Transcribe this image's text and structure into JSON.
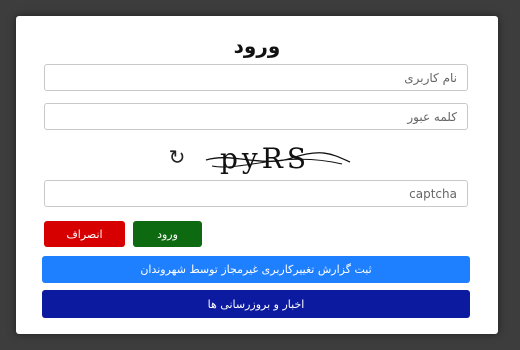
{
  "dialog": {
    "title": "ورود"
  },
  "form": {
    "username_placeholder": "نام کاربری",
    "password_placeholder": "کلمه عبور",
    "captcha_placeholder": "captcha",
    "captcha_text": "pyRS",
    "refresh_icon": "refresh-icon"
  },
  "buttons": {
    "login_label": "ورود",
    "cancel_label": "انصراف",
    "report_label": "ثبت گزارش تغییرکاربری غیرمجاز توسط شهروندان",
    "news_label": "اخبار و بروزرسانی ها"
  },
  "colors": {
    "cancel": "#d60000",
    "login": "#0e6a11",
    "report": "#1e7fff",
    "news": "#0c1aa0"
  }
}
